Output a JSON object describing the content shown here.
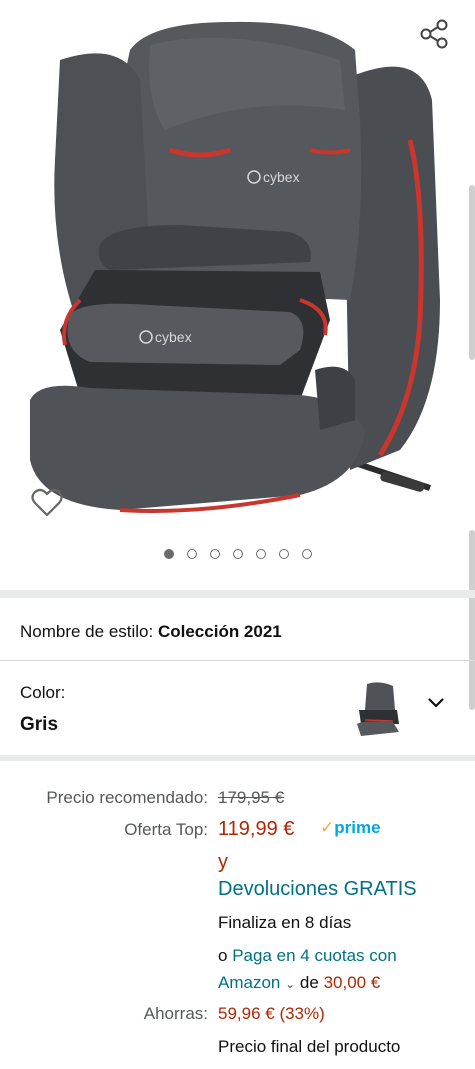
{
  "colors": {
    "price_red": "#b12704",
    "link_teal": "#007185",
    "prime_blue": "#00a8e1"
  },
  "hero": {
    "logo_text": "cybex",
    "icons": {
      "share": "share-icon",
      "wishlist": "heart-icon"
    },
    "carousel": {
      "total": 7,
      "active_index": 0
    }
  },
  "style": {
    "label": "Nombre de estilo:",
    "value": "Colección 2021"
  },
  "color": {
    "label": "Color:",
    "value": "Gris",
    "dropdown_icon": "chevron-down-icon"
  },
  "pricing": {
    "list_label": "Precio recomendado:",
    "list_price": "179,95 €",
    "offer_label": "Oferta Top:",
    "offer_price": "119,99 €",
    "prime_check": "✓",
    "prime_text": "prime",
    "and_text": "y",
    "free_returns": "Devoluciones GRATIS",
    "ends_text": "Finaliza en 8 días",
    "installments_prefix": "o",
    "installments_link_1": "Paga en 4 cuotas con",
    "installments_link_2": "Amazon",
    "installments_suffix": "de",
    "installment_amount": "30,00 €",
    "savings_label": "Ahorras:",
    "savings_value": "59,96 € (33%)",
    "final_price_text": "Precio final del producto"
  }
}
